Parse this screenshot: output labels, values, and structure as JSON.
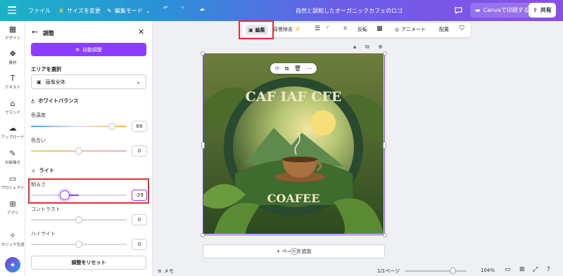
{
  "topbar": {
    "file": "ファイル",
    "resize": "サイズを変更",
    "edit_mode": "編集モード",
    "title": "自然と調和したオーガニックカフェのロゴ",
    "print": "Canvaで印刷する",
    "share": "共有"
  },
  "rail": [
    {
      "label": "デザイン",
      "icon": "▦"
    },
    {
      "label": "素材",
      "icon": "❖"
    },
    {
      "label": "テキスト",
      "icon": "T"
    },
    {
      "label": "ブランド",
      "icon": "⌂"
    },
    {
      "label": "アップロード",
      "icon": "☁"
    },
    {
      "label": "お絵描き",
      "icon": "✎"
    },
    {
      "label": "プロジェクト",
      "icon": "▭"
    },
    {
      "label": "アプリ",
      "icon": "⊞"
    },
    {
      "label": "マジック生成",
      "icon": "✧"
    }
  ],
  "panel": {
    "title": "調整",
    "auto_adjust": "自動調整",
    "area_heading": "エリアを選択",
    "area_value": "画像全体",
    "white_balance": "ホワイトバランス",
    "temperature_label": "色温度",
    "temperature_value": "69",
    "temperature_level": 69,
    "tint_label": "色合い",
    "tint_value": "0",
    "tint_level": 0,
    "light": "ライト",
    "brightness_label": "明るさ",
    "brightness_value": "-29",
    "brightness_level": -29,
    "contrast_label": "コントラスト",
    "contrast_value": "0",
    "contrast_level": 0,
    "highlight_label": "ハイライト",
    "highlight_value": "0",
    "highlight_level": 0,
    "reset": "調整をリセット"
  },
  "context_toolbar": {
    "edit": "編集",
    "bg_remove": "背景除去",
    "flip": "反転",
    "animate": "アニメート",
    "position": "配置"
  },
  "canvas": {
    "logo_top_text": "CAF IAF CFE",
    "logo_bottom_text": "COAFEE",
    "add_page": "+ ページを追加"
  },
  "bottombar": {
    "notes": "メモ",
    "page": "1/1ページ",
    "zoom": "104%",
    "zoom_level": 104
  },
  "colors": {
    "accent": "#8b3dff",
    "highlight": "#e03131"
  }
}
